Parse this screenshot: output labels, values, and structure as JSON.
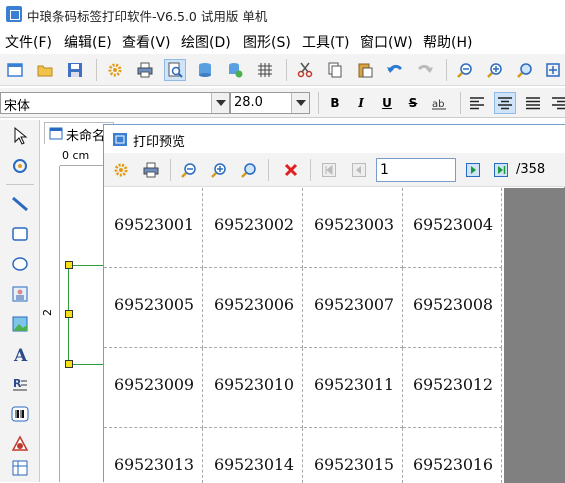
{
  "app": {
    "title": "中琅条码标签打印软件-V6.5.0 试用版 单机"
  },
  "menu": [
    "文件(F)",
    "编辑(E)",
    "查看(V)",
    "绘图(D)",
    "图形(S)",
    "工具(T)",
    "窗口(W)",
    "帮助(H)"
  ],
  "format": {
    "font_name": "宋体",
    "font_size": "28.0",
    "bold": "B",
    "italic": "I",
    "underline": "U",
    "strike": "S"
  },
  "document": {
    "tab_label": "未命名",
    "ruler_unit": "0 cm",
    "ruler_mark": "2"
  },
  "preview": {
    "title": "打印预览",
    "page_input": "1",
    "page_total": "/358",
    "labels": [
      "69523001",
      "69523002",
      "69523003",
      "69523004",
      "69523005",
      "69523006",
      "69523007",
      "69523008",
      "69523009",
      "69523010",
      "69523011",
      "69523012",
      "69523013",
      "69523014",
      "69523015",
      "69523016"
    ]
  },
  "colors": {
    "accent": "#3b7fd4",
    "selection_handle": "#f4e11a"
  }
}
